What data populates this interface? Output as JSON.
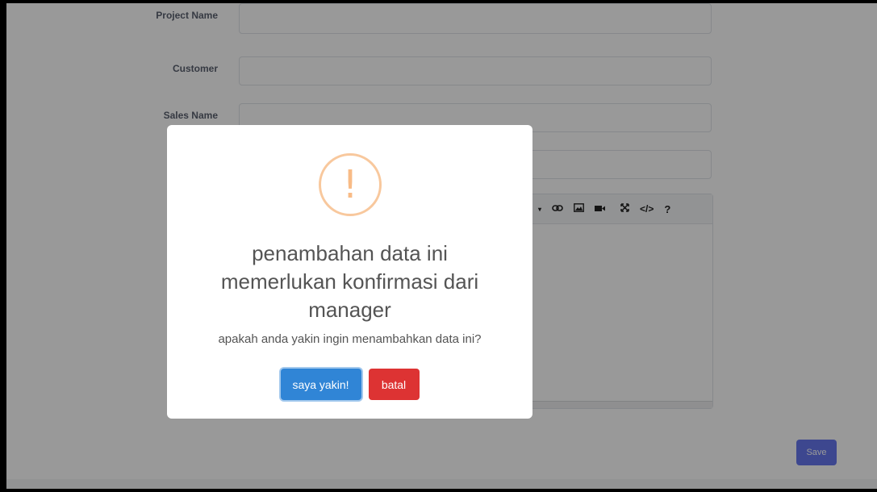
{
  "form": {
    "project_name_label": "Project Name",
    "customer_label": "Customer",
    "sales_name_label": "Sales Name",
    "project_name_value": "",
    "customer_value": "",
    "sales_name_value": "",
    "save_label": "Save"
  },
  "editor_toolbar": {
    "icons": [
      "caret-down-icon",
      "link-icon",
      "image-icon",
      "video-icon",
      "fullscreen-icon",
      "code-view-icon",
      "help-icon"
    ]
  },
  "dialog": {
    "icon": "warning-icon",
    "title": "penambahan data ini memerlukan konfirmasi dari manager",
    "text": "apakah anda yakin ingin menambahkan data ini?",
    "confirm_label": "saya yakin!",
    "cancel_label": "batal",
    "colors": {
      "confirm": "#3085d6",
      "cancel": "#dd3333",
      "warning": "#f8bb86"
    }
  }
}
